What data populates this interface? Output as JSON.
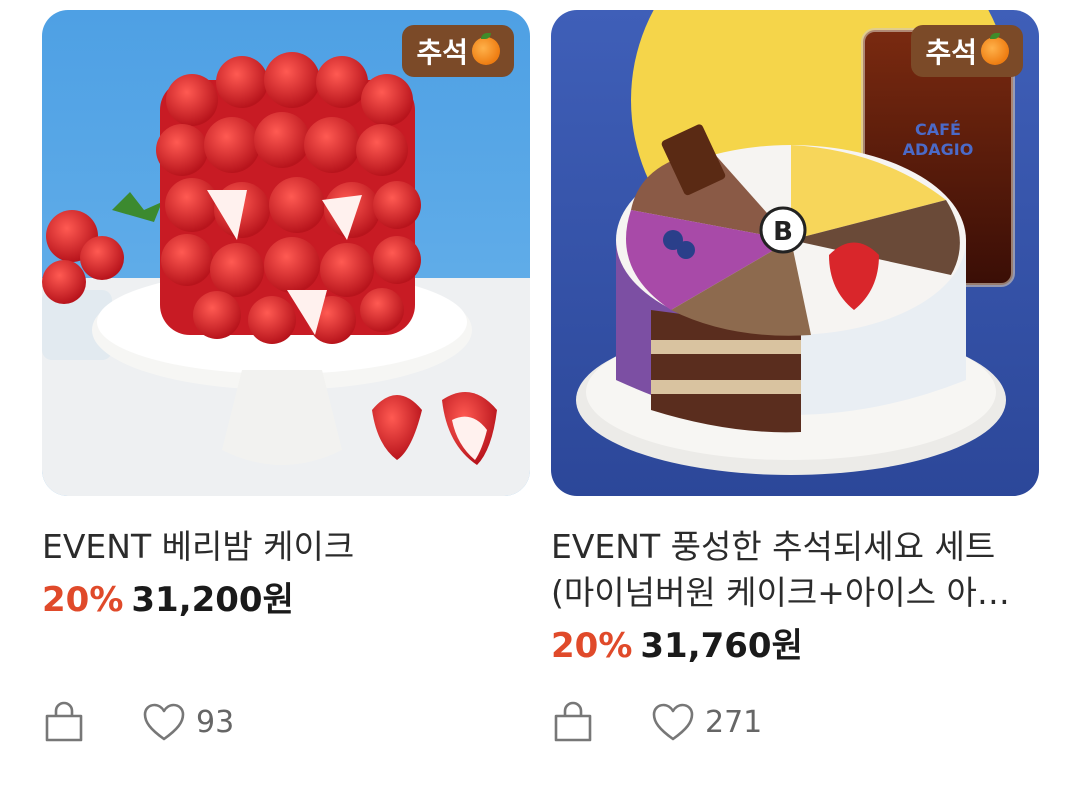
{
  "products": [
    {
      "badge": "추석",
      "title": "EVENT 베리밤 케이크",
      "discount": "20%",
      "price": "31,200원",
      "likes": "93",
      "image_icon": "strawberry-cake-image"
    },
    {
      "badge": "추석",
      "title": "EVENT 풍성한 추석되세요 세트 (마이넘버원 케이크+아이스 아…",
      "discount": "20%",
      "price": "31,760원",
      "likes": "271",
      "image_icon": "number-one-cake-set-image",
      "cup_brand": "CAFÉ ADAGIO",
      "cake_logo": "B"
    }
  ],
  "colors": {
    "badge_bg": "#7b4a28",
    "discount": "#e04a2a",
    "sky_blue": "#5aa9e6",
    "moon_yellow": "#f5d54a",
    "strawberry_red": "#d9262b"
  }
}
